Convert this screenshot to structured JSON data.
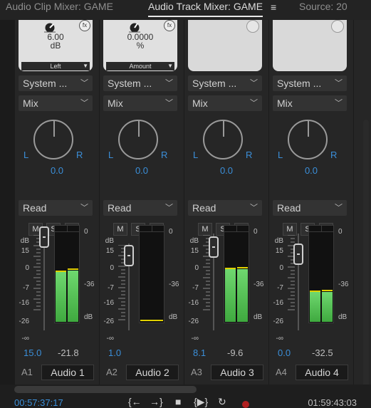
{
  "tabs": [
    {
      "label": "Audio Clip Mixer: GAME"
    },
    {
      "label": "Audio Track Mixer: GAME"
    },
    {
      "label": "Source: 20"
    }
  ],
  "tab_menu_icon": "hamburger-menu-icon",
  "strips": [
    {
      "fx_value": "6.00",
      "fx_unit": "dB",
      "fx_param": "Left",
      "input": "System ...",
      "mode": "Mix",
      "pan_left": "L",
      "pan_right": "R",
      "pan_value": "0.0",
      "automation": "Read",
      "m": "M",
      "s": "S",
      "r": "R",
      "volume": "15.0",
      "peak": "-21.8",
      "id": "A1",
      "name": "Audio 1",
      "meter_left": 0.55,
      "meter_right": 0.56
    },
    {
      "fx_value": "0.0000",
      "fx_unit": "%",
      "fx_param": "Amount",
      "input": "System ...",
      "mode": "Mix",
      "pan_left": "L",
      "pan_right": "R",
      "pan_value": "0.0",
      "automation": "Read",
      "m": "M",
      "s": "S",
      "r": "R",
      "volume": "1.0",
      "peak": "",
      "id": "A2",
      "name": "Audio 2",
      "meter_left": 0.0,
      "meter_right": 0.0
    },
    {
      "fx_value": "",
      "fx_unit": "",
      "fx_param": "",
      "input": "System ...",
      "mode": "Mix",
      "pan_left": "L",
      "pan_right": "R",
      "pan_value": "0.0",
      "automation": "Read",
      "m": "M",
      "s": "S",
      "r": "R",
      "volume": "8.1",
      "peak": "-9.6",
      "id": "A3",
      "name": "Audio 3",
      "meter_left": 0.58,
      "meter_right": 0.58
    },
    {
      "fx_value": "",
      "fx_unit": "",
      "fx_param": "",
      "input": "System ...",
      "mode": "Mix",
      "pan_left": "L",
      "pan_right": "R",
      "pan_value": "0.0",
      "automation": "Read",
      "m": "M",
      "s": "S",
      "r": "R",
      "volume": "0.0",
      "peak": "-32.5",
      "id": "A4",
      "name": "Audio 4",
      "meter_left": 0.33,
      "meter_right": 0.33
    }
  ],
  "fader_scale": [
    "dB",
    "15",
    "0",
    "-7",
    "-16",
    "-26",
    "-∞"
  ],
  "meter_scale": [
    "0",
    "-36",
    "dB"
  ],
  "transport": {
    "timecode_current": "00:57:37:17",
    "timecode_end": "01:59:43:03",
    "buttons": [
      "{←",
      "→}",
      "■",
      "{▶}",
      "↻",
      "●"
    ]
  }
}
